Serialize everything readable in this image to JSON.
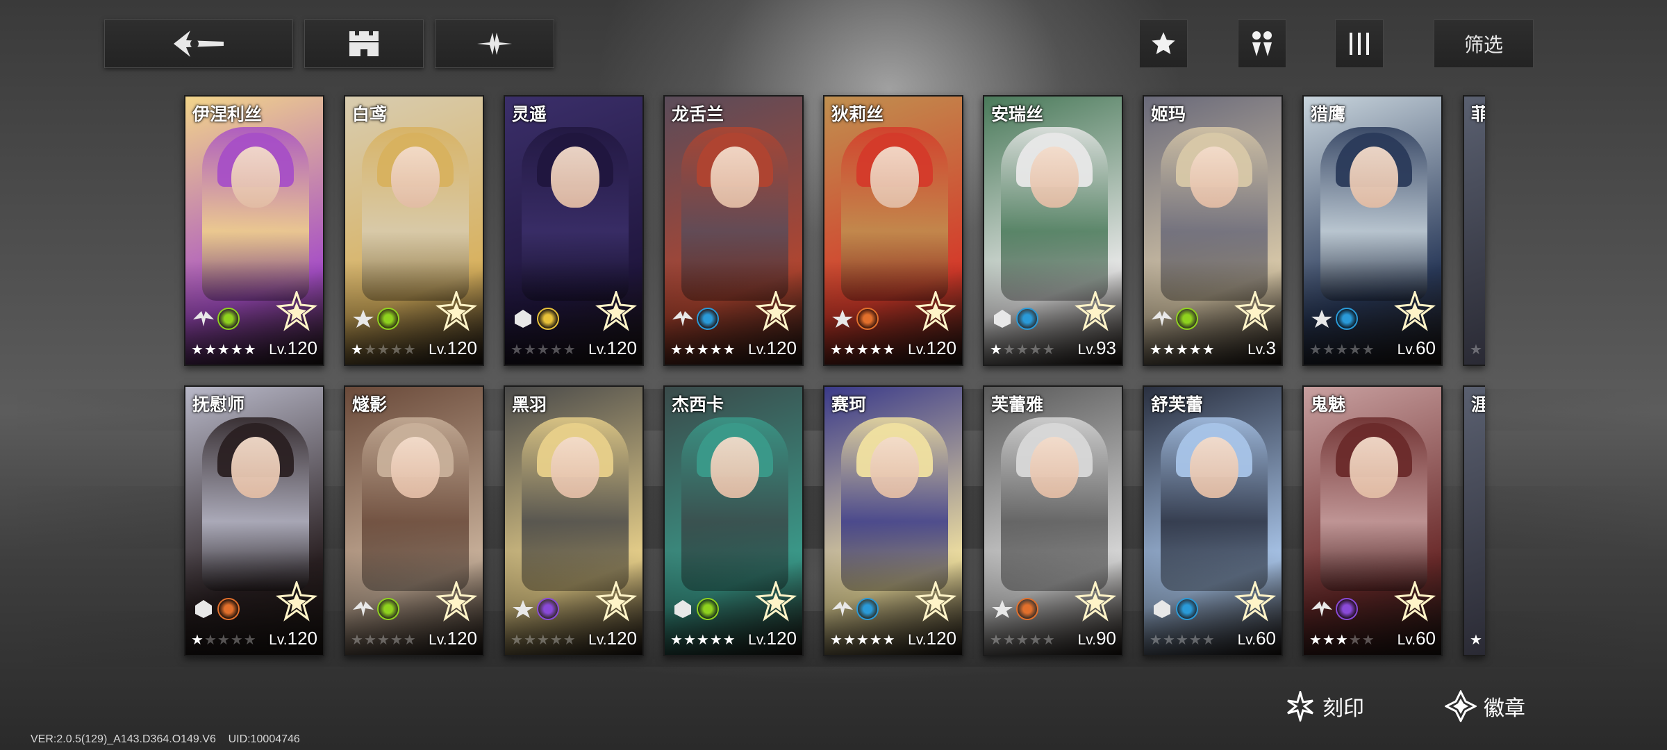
{
  "topbar": {
    "back_icon": "back-arrow-icon",
    "base_icon": "castle-icon",
    "wave_icon": "sparkle-wave-icon",
    "favorite_icon": "star-icon",
    "team_icon": "team-icon",
    "sort_icon": "column-bars-icon",
    "filter_label": "筛选"
  },
  "rows": [
    [
      {
        "name": "伊涅利丝",
        "stars": 5,
        "level": "120",
        "element": "nature",
        "palette": [
          "#f2d58a",
          "#a64fc6"
        ]
      },
      {
        "name": "白鸢",
        "stars": 1,
        "level": "120",
        "element": "nature",
        "palette": [
          "#d8ccb0",
          "#d8b15e"
        ]
      },
      {
        "name": "灵遥",
        "stars": 0,
        "level": "120",
        "element": "light",
        "palette": [
          "#3b2f6a",
          "#20163e"
        ]
      },
      {
        "name": "龙舌兰",
        "stars": 5,
        "level": "120",
        "element": "water",
        "palette": [
          "#5a4c5a",
          "#b04530"
        ]
      },
      {
        "name": "狄莉丝",
        "stars": 5,
        "level": "120",
        "element": "fire",
        "palette": [
          "#c09050",
          "#d43a2a"
        ]
      },
      {
        "name": "安瑞丝",
        "stars": 1,
        "level": "93",
        "element": "water",
        "palette": [
          "#4a7a5a",
          "#e8e8e8"
        ]
      },
      {
        "name": "姬玛",
        "stars": 5,
        "level": "3",
        "element": "nature",
        "palette": [
          "#6a6a7a",
          "#d8c8a8"
        ]
      },
      {
        "name": "猎鹰",
        "stars": 0,
        "level": "60",
        "element": "water",
        "palette": [
          "#c8d4dc",
          "#2a3a5a"
        ]
      }
    ],
    [
      {
        "name": "抚慰师",
        "stars": 1,
        "level": "120",
        "element": "fire",
        "palette": [
          "#b8b8c8",
          "#2a2022"
        ]
      },
      {
        "name": "燧影",
        "stars": 0,
        "level": "120",
        "element": "nature",
        "palette": [
          "#6a4a3a",
          "#c8b09a"
        ]
      },
      {
        "name": "黑羽",
        "stars": 0,
        "level": "120",
        "element": "void",
        "palette": [
          "#4a4a4a",
          "#e8d08a"
        ]
      },
      {
        "name": "杰西卡",
        "stars": 5,
        "level": "120",
        "element": "nature",
        "palette": [
          "#3a4a4a",
          "#3a9a8a"
        ]
      },
      {
        "name": "赛珂",
        "stars": 5,
        "level": "120",
        "element": "water",
        "palette": [
          "#3a3a8a",
          "#f0e0a0"
        ]
      },
      {
        "name": "芙蕾雅",
        "stars": 0,
        "level": "90",
        "element": "fire",
        "palette": [
          "#5a5a5a",
          "#d8d8d8"
        ]
      },
      {
        "name": "舒芙蕾",
        "stars": 0,
        "level": "60",
        "element": "water",
        "palette": [
          "#2a3040",
          "#a8c4e8"
        ]
      },
      {
        "name": "鬼魅",
        "stars": 3,
        "level": "60",
        "element": "void",
        "palette": [
          "#c8a0a0",
          "#6a2a2a"
        ]
      }
    ]
  ],
  "partial_cards": [
    {
      "name": "菲",
      "stars": 0
    },
    {
      "name": "涯",
      "stars": 1
    }
  ],
  "level_prefix": "Lv.",
  "element_colors": {
    "nature": "#8fd21f",
    "fire": "#e2702c",
    "water": "#2a9ad8",
    "light": "#e8c23a",
    "void": "#8a4ad8"
  },
  "bottom": {
    "engrave_label": "刻印",
    "emblem_label": "徽章"
  },
  "footer": {
    "version": "VER:2.0.5(129)_A143.D364.O149.V6",
    "uid": "UID:10004746"
  }
}
